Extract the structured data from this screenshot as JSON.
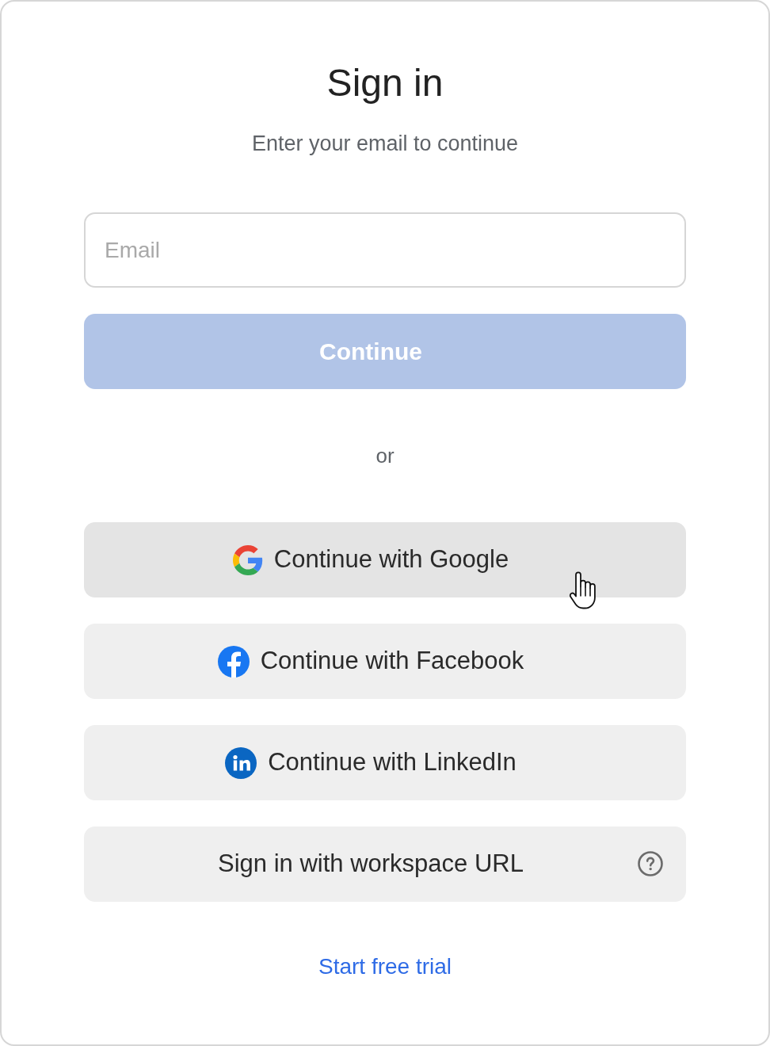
{
  "title": "Sign in",
  "subtitle": "Enter your email to continue",
  "email_field": {
    "placeholder": "Email"
  },
  "continue_button": {
    "label": "Continue",
    "disabled": true
  },
  "divider": "or",
  "sign_in_options": [
    {
      "kind": "google",
      "label": "Continue with Google",
      "hovered": true
    },
    {
      "kind": "facebook",
      "label": "Continue with Facebook",
      "hovered": false
    },
    {
      "kind": "linkedin",
      "label": "Continue with LinkedIn",
      "hovered": false
    },
    {
      "kind": "workspace",
      "label": "Sign in with workspace URL",
      "hovered": false
    }
  ],
  "trial_link": "Start free trial"
}
